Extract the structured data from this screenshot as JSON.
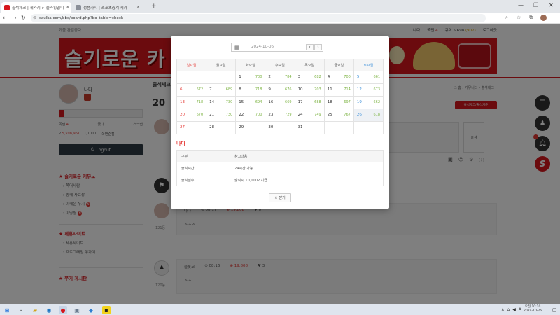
{
  "browser": {
    "tabs": [
      {
        "title": "출석체크 | 제카키 > 슬카킹입니",
        "active": true,
        "fav_color": "#d6161c"
      },
      {
        "title": "정품카지 | 스포츠중계 제카",
        "active": false,
        "fav_color": "#8a8f98"
      },
      {
        "title": "슬카키 | 슬카키 제카키 사이트",
        "active": false,
        "fav_color": "#d6161c"
      }
    ],
    "url": "saulka.com/bbs/board.php?bo_table=check"
  },
  "site": {
    "topline": "가볼 관일좋다",
    "toplinks": {
      "name": "나다",
      "level_label": "쪽쩐",
      "level_value": "4",
      "points_label": "큐머",
      "points_value": "5,698",
      "points_sub": "(907)",
      "logout": "로그아웃"
    },
    "banner_title": "슬기로운 카"
  },
  "sidebar": {
    "username": "나다",
    "stats": {
      "level_label": "쪽쩐",
      "level_value": "4",
      "tank": "꽂다",
      "scrap": "스크랩"
    },
    "points": {
      "symbol": "P",
      "value": "5,598,961",
      "extra1": "1,100.0",
      "extra2": "쪽쩐순점"
    },
    "logout_label": "Logout",
    "section1_title": "슬기로운 커뮤노",
    "section1_items": [
      {
        "label": "쪽더사람",
        "badge": ""
      },
      {
        "label": "방쩨 자료장",
        "badge": ""
      },
      {
        "label": "이쩨운 쭈기",
        "badge": "N"
      },
      {
        "label": "이딩짱",
        "badge": "N"
      }
    ],
    "section2_title": "제휴사이트",
    "section2_items": [
      {
        "label": "제휴사이트"
      },
      {
        "label": "프로그래밍 쭈가이"
      }
    ],
    "section3_title": "쭈기 게시판"
  },
  "content": {
    "title": "출석체크",
    "big_date": "20",
    "breadcrumb": "☖ 홈 › 커뮤니티 › 출석체크",
    "red_button": "출석체크/출석기준",
    "confirm_label": "출석",
    "flag_icon": "flag-icon",
    "comments": [
      {
        "name": "나다",
        "time": "08:17",
        "points": "19,808",
        "count": "0",
        "body": "ㅅㅅㅅ",
        "rank": "121등"
      },
      {
        "name": "슬롯코",
        "time": "08:16",
        "points": "19,808",
        "count": "3",
        "body": "ㅈㅈ",
        "rank": "120등"
      }
    ]
  },
  "modal": {
    "date_value": "2024-10-06",
    "weekdays": [
      "일요일",
      "월요일",
      "화요일",
      "수요일",
      "목요일",
      "금요일",
      "토요일"
    ],
    "weeks": [
      [
        null,
        null,
        {
          "d": "1",
          "c": "700"
        },
        {
          "d": "2",
          "c": "784"
        },
        {
          "d": "3",
          "c": "682"
        },
        {
          "d": "4",
          "c": "700"
        },
        {
          "d": "5",
          "c": "661"
        }
      ],
      [
        {
          "d": "6",
          "c": "672"
        },
        {
          "d": "7",
          "c": "689"
        },
        {
          "d": "8",
          "c": "718"
        },
        {
          "d": "9",
          "c": "676"
        },
        {
          "d": "10",
          "c": "703"
        },
        {
          "d": "11",
          "c": "714"
        },
        {
          "d": "12",
          "c": "673"
        }
      ],
      [
        {
          "d": "13",
          "c": "718"
        },
        {
          "d": "14",
          "c": "730"
        },
        {
          "d": "15",
          "c": "694"
        },
        {
          "d": "16",
          "c": "669"
        },
        {
          "d": "17",
          "c": "688"
        },
        {
          "d": "18",
          "c": "697"
        },
        {
          "d": "19",
          "c": "662"
        }
      ],
      [
        {
          "d": "20",
          "c": "670"
        },
        {
          "d": "21",
          "c": "730"
        },
        {
          "d": "22",
          "c": "700"
        },
        {
          "d": "23",
          "c": "729"
        },
        {
          "d": "24",
          "c": "749"
        },
        {
          "d": "25",
          "c": "767"
        },
        {
          "d": "26",
          "c": "618"
        }
      ],
      [
        {
          "d": "27",
          "c": ""
        },
        {
          "d": "28",
          "c": ""
        },
        {
          "d": "29",
          "c": ""
        },
        {
          "d": "30",
          "c": ""
        },
        {
          "d": "31",
          "c": ""
        },
        null,
        null
      ]
    ],
    "member_name": "나다",
    "info_headers": [
      "구분",
      "참고내용"
    ],
    "info_rows": [
      [
        "출석시간",
        "24시간 가능"
      ],
      [
        "출석점수",
        "출석시 10,000P 지급"
      ]
    ],
    "close_label": "닫기"
  },
  "taskbar": {
    "time": "오전 10:10",
    "date": "2024-10-26"
  },
  "colors": {
    "brand_red": "#d6161c",
    "point_green": "#7cb342",
    "saturday_blue": "#3b8fd9"
  }
}
